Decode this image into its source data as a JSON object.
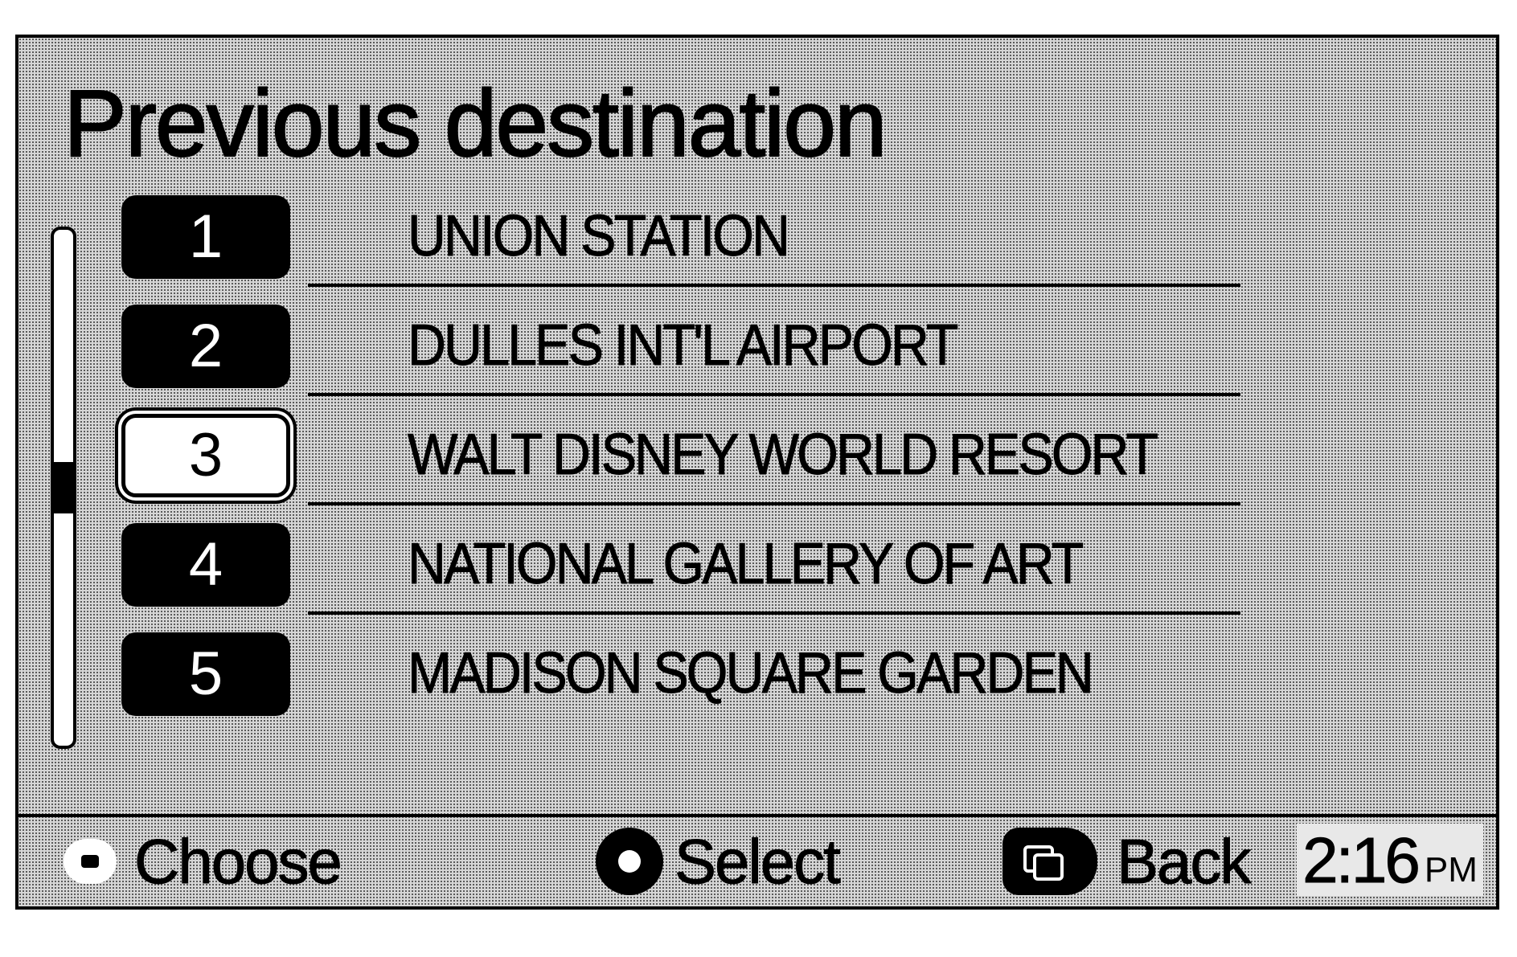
{
  "screen": {
    "title": "Previous destination"
  },
  "scrollbar": {
    "position_fraction": 0.5,
    "thumb_fraction": 0.1
  },
  "destinations": [
    {
      "number": "1",
      "name": "UNION STATION",
      "selected": false
    },
    {
      "number": "2",
      "name": "DULLES INT'L AIRPORT",
      "selected": false
    },
    {
      "number": "3",
      "name": "WALT DISNEY WORLD RESORT",
      "selected": true
    },
    {
      "number": "4",
      "name": "NATIONAL GALLERY OF ART",
      "selected": false
    },
    {
      "number": "5",
      "name": "MADISON SQUARE GARDEN",
      "selected": false
    }
  ],
  "footer": {
    "choose_label": "Choose",
    "choose_icon": "dial-icon",
    "select_label": "Select",
    "select_icon": "select-knob-icon",
    "back_label": "Back",
    "back_icon": "back-button-icon"
  },
  "clock": {
    "time": "2:16",
    "ampm": "PM"
  }
}
